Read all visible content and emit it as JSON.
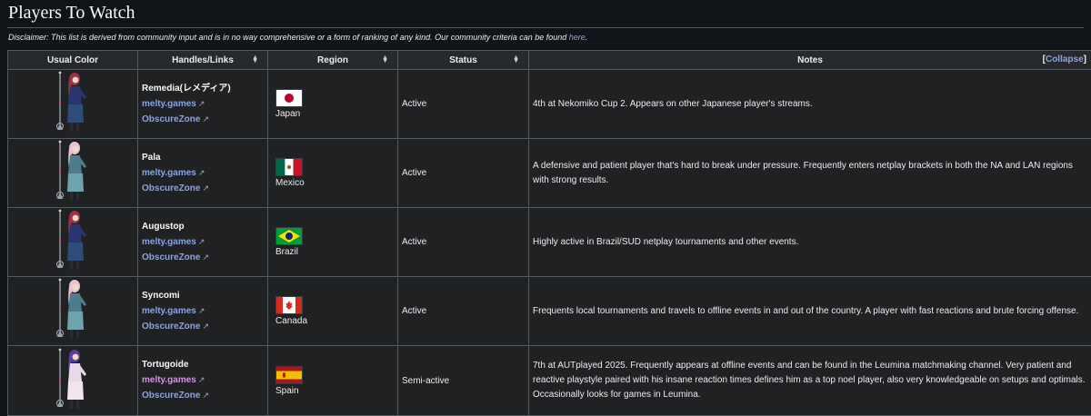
{
  "section": {
    "heading": "Players To Watch",
    "disclaimer_text": "Disclaimer: This list is derived from community input and is in no way comprehensive or a form of ranking of any kind. Our community criteria can be found ",
    "disclaimer_link": "here",
    "disclaimer_end": "."
  },
  "columns": [
    "Usual Color",
    "Handles/Links",
    "Region",
    "Status",
    "Notes"
  ],
  "collapse": {
    "open": "[",
    "label": "Collapse",
    "close": "]"
  },
  "ext_icon": "↗",
  "colors": {
    "link": "#88a3e8",
    "link_pink": "#d591e6"
  },
  "players": [
    {
      "name": "Remedia(レメディア)",
      "link1": "melty.games",
      "link2": "ObscureZone",
      "region": "Japan",
      "flag": "jp",
      "status": "Active",
      "notes": "4th at Nekomiko Cup 2. Appears on other Japanese player's streams.",
      "sprite": {
        "hair": "#9a3445",
        "coat": "#28356e",
        "skirt": "#2d4c78"
      }
    },
    {
      "name": "Pala",
      "link1": "melty.games",
      "link2": "ObscureZone",
      "region": "Mexico",
      "flag": "mx",
      "status": "Active",
      "notes": "A defensive and patient player that's hard to break under pressure. Frequently enters netplay brackets in both the NA and LAN regions with strong results.",
      "sprite": {
        "hair": "#e7c2d2",
        "coat": "#4d7d8c",
        "skirt": "#6fa3ae"
      }
    },
    {
      "name": "Augustop",
      "link1": "melty.games",
      "link2": "ObscureZone",
      "region": "Brazil",
      "flag": "br",
      "status": "Active",
      "notes": "Highly active in Brazil/SUD netplay tournaments and other events.",
      "sprite": {
        "hair": "#9a3445",
        "coat": "#28356e",
        "skirt": "#2d4c78"
      }
    },
    {
      "name": "Syncomi",
      "link1": "melty.games",
      "link2": "ObscureZone",
      "region": "Canada",
      "flag": "ca",
      "status": "Active",
      "notes": "Frequents local tournaments and travels to offline events in and out of the country. A player with fast reactions and brute forcing offense.",
      "sprite": {
        "hair": "#e7c2d2",
        "coat": "#4d7d8c",
        "skirt": "#6fa3ae"
      }
    },
    {
      "name": "Tortugoide",
      "link1": "melty.games",
      "link2": "ObscureZone",
      "region": "Spain",
      "flag": "es",
      "status": "Semi-active",
      "notes": "7th at AUTplayed 2025. Frequently appears at offline events and can be found in the Leumina matchmaking channel. Very patient and reactive playstyle paired with his insane reaction times defines him as a top noel player, also very knowledgeable on setups and optimals. Occasionally looks for games in Leumina.",
      "link1_color": "link_pink",
      "sprite": {
        "hair": "#5b3f9a",
        "coat": "#e8d8ea",
        "skirt": "#f1e6f0"
      }
    }
  ]
}
